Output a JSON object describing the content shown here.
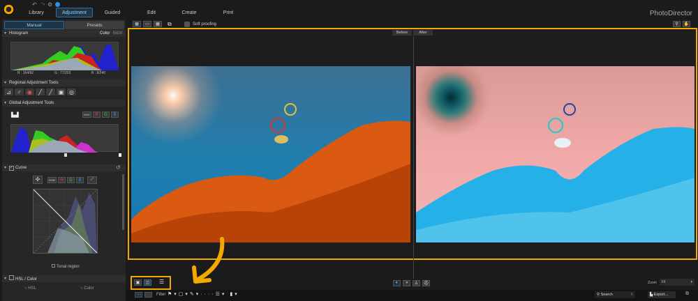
{
  "app": {
    "brand": "PhotoDirector"
  },
  "nav": {
    "tabs": [
      "Library",
      "Adjustment",
      "Guided",
      "Edit",
      "Create",
      "Print"
    ],
    "active": "Adjustment"
  },
  "left": {
    "tabs": [
      "Manual",
      "Presets"
    ],
    "histogram": {
      "title": "Histogram",
      "modes": [
        "Color",
        "B&W"
      ],
      "r": "R : 164/92",
      "g": "G : 77/203",
      "b": "B : 8/240"
    },
    "regional": {
      "title": "Regional Adjustment Tools"
    },
    "global": {
      "title": "Global Adjustment Tools",
      "channels": [
        "HSV",
        "R",
        "G",
        "B"
      ]
    },
    "curve": {
      "title": "Curve",
      "channels": [
        "RGB",
        "R",
        "G",
        "B"
      ],
      "tonal": "Tonal region"
    },
    "hsl": {
      "title": "HSL / Color",
      "options": [
        "HSL",
        "Color"
      ]
    }
  },
  "toolbar": {
    "soft_proofing": "Soft proofing"
  },
  "viewer": {
    "before": "Before",
    "after": "After"
  },
  "bottom": {
    "zoom_label": "Zoom",
    "zoom_value": "Fit",
    "filter": "Filter",
    "search_placeholder": "Search",
    "export": "Export..."
  },
  "colors": {
    "highlight": "#f2a900",
    "accent": "#2b6fa5"
  }
}
